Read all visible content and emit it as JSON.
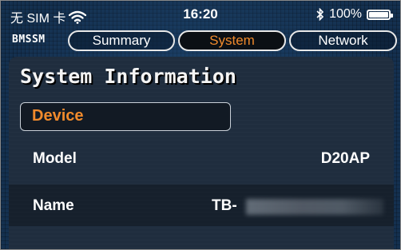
{
  "status_bar": {
    "carrier": "无 SIM 卡",
    "time": "16:20",
    "battery_percent": "100%",
    "battery_level": 1.0
  },
  "nav": {
    "brand": "BMSSM",
    "tabs": [
      {
        "label": "Summary",
        "active": false
      },
      {
        "label": "System",
        "active": true
      },
      {
        "label": "Network",
        "active": false
      }
    ]
  },
  "main": {
    "title": "System Information",
    "section": "Device",
    "rows": [
      {
        "label": "Model",
        "value": "D20AP"
      },
      {
        "label": "Name",
        "value": "TB-"
      }
    ]
  },
  "colors": {
    "accent": "#f08a2c",
    "background": "#14304f",
    "panel": "#1f2d3e"
  },
  "icons": [
    "wifi-icon",
    "bluetooth-icon",
    "battery-icon"
  ]
}
